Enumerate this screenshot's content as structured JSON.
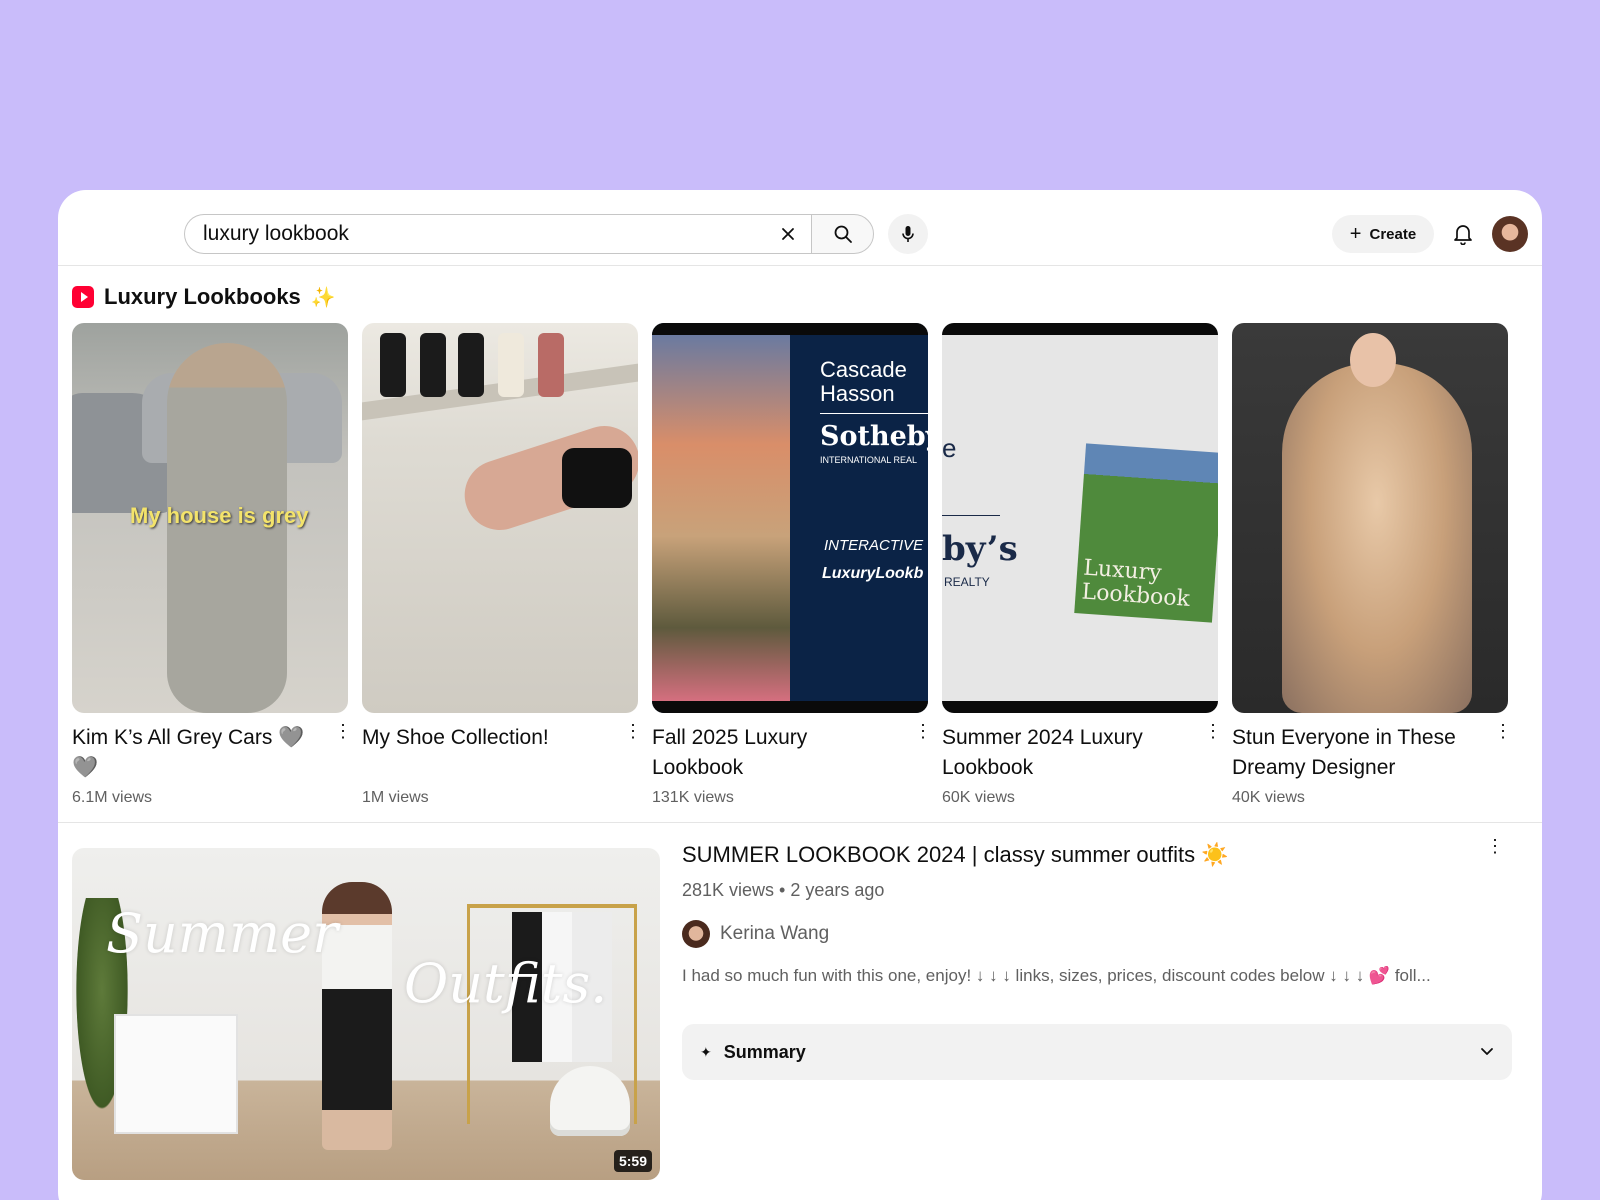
{
  "search": {
    "query": "luxury lookbook"
  },
  "header": {
    "create_label": "Create"
  },
  "shelf": {
    "title": "Luxury Lookbooks",
    "shorts": [
      {
        "title": "Kim K’s All Grey Cars 🩶 🩶",
        "views": "6.1M views",
        "caption": "My house is grey"
      },
      {
        "title": "My Shoe Collection!",
        "views": "1M views"
      },
      {
        "title": "Fall 2025 Luxury Lookbook",
        "views": "131K views",
        "thumb_text": [
          "Cascade",
          "Hasson",
          "Sotheby’",
          "INTERNATIONAL REAL",
          "INTERACTIVE",
          "LuxuryLookb"
        ]
      },
      {
        "title": "Summer 2024 Luxury Lookbook",
        "views": "60K views",
        "thumb_text": [
          "e",
          "by’s",
          "REALTY",
          "Luxury",
          "Lookbook"
        ]
      },
      {
        "title": "Stun Everyone in These Dreamy Designer Gown...",
        "views": "40K views"
      }
    ]
  },
  "video": {
    "title": "SUMMER LOOKBOOK 2024 | classy summer outfits ☀️",
    "meta": "281K views • 2 years ago",
    "channel": "Kerina Wang",
    "description": "I had so much fun with this one, enjoy! ↓ ↓ ↓ links, sizes, prices, discount codes below ↓ ↓ ↓ 💕  foll...",
    "duration": "5:59",
    "thumb_text": [
      "Summer",
      "Outfits."
    ],
    "summary_label": "Summary"
  },
  "colors": {
    "background": "#c9bcfa",
    "shorts_red": "#ff0033",
    "secondary_text": "#606060"
  }
}
